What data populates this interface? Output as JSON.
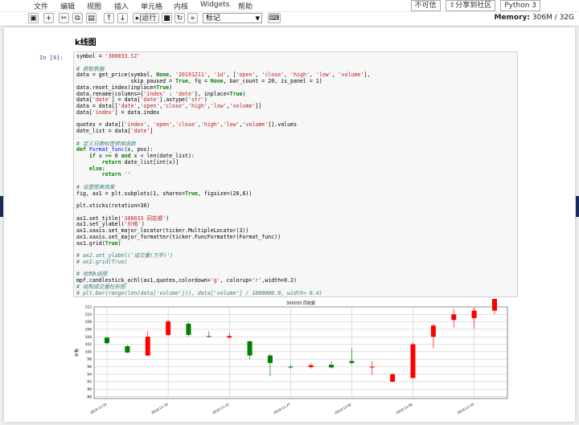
{
  "menu": [
    "文件",
    "编辑",
    "视图",
    "插入",
    "单元格",
    "内核",
    "Widgets",
    "帮助"
  ],
  "kernel": {
    "trusted": "不可信",
    "share": "分享到社区",
    "language": "Python 3"
  },
  "toolbar": {
    "run_label": "运行",
    "cell_type": "标记"
  },
  "memory": {
    "label": "Memory:",
    "value": "306M / 32G"
  },
  "heading": "k线图",
  "cell": {
    "prompt": "In  [9]:",
    "lines": [
      [
        [
          "",
          "symbol = "
        ],
        [
          "st",
          "'300033.SZ'"
        ]
      ],
      [],
      [
        [
          "cm",
          "# 获取数据"
        ]
      ],
      [
        [
          "",
          "data = get_price(symbol, "
        ],
        [
          "kw",
          "None"
        ],
        [
          "",
          ", "
        ],
        [
          "st",
          "'20191211'"
        ],
        [
          "",
          ", "
        ],
        [
          "st",
          "'1d'"
        ],
        [
          "",
          ", ["
        ],
        [
          "st",
          "'open'"
        ],
        [
          "",
          ", "
        ],
        [
          "st",
          "'close'"
        ],
        [
          "",
          ", "
        ],
        [
          "st",
          "'high'"
        ],
        [
          "",
          ", "
        ],
        [
          "st",
          "'low'"
        ],
        [
          "",
          ", "
        ],
        [
          "st",
          "'volume'"
        ],
        [
          "",
          "],"
        ]
      ],
      [
        [
          "",
          "                 skip_paused = "
        ],
        [
          "kw",
          "True"
        ],
        [
          "",
          ", fq = "
        ],
        [
          "kw",
          "None"
        ],
        [
          "",
          ", bar_count = 20, is_panel = 1)"
        ]
      ],
      [
        [
          "",
          "data.reset_index(inplace="
        ],
        [
          "kw",
          "True"
        ],
        [
          "",
          ")"
        ]
      ],
      [
        [
          "",
          "data.rename(columns={"
        ],
        [
          "st",
          "'index'"
        ],
        [
          "",
          " : "
        ],
        [
          "st",
          "'date'"
        ],
        [
          "",
          "}, inplace="
        ],
        [
          "kw",
          "True"
        ],
        [
          "",
          ")"
        ]
      ],
      [
        [
          "",
          "data["
        ],
        [
          "st",
          "'date'"
        ],
        [
          "",
          "] = data["
        ],
        [
          "st",
          "'date'"
        ],
        [
          "",
          "].astype("
        ],
        [
          "st",
          "'str'"
        ],
        [
          "",
          ")"
        ]
      ],
      [
        [
          "",
          "data = data[["
        ],
        [
          "st",
          "'date'"
        ],
        [
          "",
          ","
        ],
        [
          "st",
          "'open'"
        ],
        [
          "",
          ","
        ],
        [
          "st",
          "'close'"
        ],
        [
          "",
          ","
        ],
        [
          "st",
          "'high'"
        ],
        [
          "",
          ","
        ],
        [
          "st",
          "'low'"
        ],
        [
          "",
          ","
        ],
        [
          "st",
          "'volume'"
        ],
        [
          "",
          "]]"
        ]
      ],
      [
        [
          "",
          "data["
        ],
        [
          "st",
          "'index'"
        ],
        [
          "",
          "] = data.index"
        ]
      ],
      [],
      [
        [
          "",
          "quotes = data[["
        ],
        [
          "st",
          "'index'"
        ],
        [
          "",
          ", "
        ],
        [
          "st",
          "'open'"
        ],
        [
          "",
          ","
        ],
        [
          "st",
          "'close'"
        ],
        [
          "",
          ","
        ],
        [
          "st",
          "'high'"
        ],
        [
          "",
          ","
        ],
        [
          "st",
          "'low'"
        ],
        [
          "",
          ","
        ],
        [
          "st",
          "'volume'"
        ],
        [
          "",
          "]].values"
        ]
      ],
      [
        [
          "",
          "date_list = data["
        ],
        [
          "st",
          "'date'"
        ],
        [
          "",
          "]"
        ]
      ],
      [],
      [
        [
          "cm",
          "# 定义日期标签转换函数"
        ]
      ],
      [
        [
          "kw",
          "def "
        ],
        [
          "fn",
          "Format_func"
        ],
        [
          "",
          "(x, pos):"
        ]
      ],
      [
        [
          "",
          "    "
        ],
        [
          "kw",
          "if"
        ],
        [
          "",
          " x "
        ],
        [
          "kw",
          ">="
        ],
        [
          "",
          " 0 "
        ],
        [
          "kw",
          "and"
        ],
        [
          "",
          " x < len(date_list):"
        ]
      ],
      [
        [
          "",
          "        "
        ],
        [
          "kw",
          "return"
        ],
        [
          "",
          " date_list[int(x)]"
        ]
      ],
      [
        [
          "",
          "    "
        ],
        [
          "kw",
          "else"
        ],
        [
          "",
          ":"
        ]
      ],
      [
        [
          "",
          "        "
        ],
        [
          "kw",
          "return"
        ],
        [
          "",
          " "
        ],
        [
          "st",
          "''"
        ]
      ],
      [],
      [
        [
          "cm",
          "# 设置图表效果"
        ]
      ],
      [
        [
          "",
          "fig, ax1 = plt.subplots(1, sharex="
        ],
        [
          "kw",
          "True"
        ],
        [
          "",
          ", figsize=(20,6))"
        ]
      ],
      [],
      [
        [
          "",
          "plt.xticks(rotation=30)"
        ]
      ],
      [],
      [
        [
          "",
          "ax1.set_title("
        ],
        [
          "st",
          "'300033 同花顺'"
        ],
        [
          "",
          ")"
        ]
      ],
      [
        [
          "",
          "ax1.set_ylabel("
        ],
        [
          "st",
          "'价格'"
        ],
        [
          "",
          ")"
        ]
      ],
      [
        [
          "",
          "ax1.xaxis.set_major_locator(ticker.MultipleLocator(3))"
        ]
      ],
      [
        [
          "",
          "ax1.xaxis.set_major_formatter(ticker.FuncFormatter(Format_func))"
        ]
      ],
      [
        [
          "",
          "ax1.grid("
        ],
        [
          "kw",
          "True"
        ],
        [
          "",
          ")"
        ]
      ],
      [],
      [
        [
          "cm",
          "# ax2.set_ylabel('成交量(万手)')"
        ]
      ],
      [
        [
          "cm",
          "# ax2.grid(True)"
        ]
      ],
      [],
      [
        [
          "cm",
          "# 绘制k线图"
        ]
      ],
      [
        [
          "",
          "mpf.candlestick_ochl(ax1,quotes,colordown="
        ],
        [
          "st",
          "'g'"
        ],
        [
          "",
          ", colorup="
        ],
        [
          "st",
          "'r'"
        ],
        [
          "",
          ",width=0.2)"
        ]
      ],
      [
        [
          "cm",
          "# 绘制成交量柱形图"
        ]
      ],
      [
        [
          "cm",
          "# plt.bar(range(len(data['volume'])), data['volume'] / 1000000.0, width= 0.4)"
        ]
      ],
      [],
      [
        [
          "",
          "plt.show()"
        ]
      ]
    ]
  },
  "chart_data": {
    "type": "candlestick",
    "title": "300033 同花顺",
    "ylabel": "价格",
    "ylim": [
      87.5,
      112
    ],
    "yticks": [
      88,
      90,
      92,
      94,
      96,
      98,
      100,
      102,
      104,
      106,
      108,
      110,
      112
    ],
    "xticks": [
      {
        "index": 0,
        "label": "2019-11-14"
      },
      {
        "index": 3,
        "label": "2019-11-19"
      },
      {
        "index": 6,
        "label": "2019-11-22"
      },
      {
        "index": 9,
        "label": "2019-11-27"
      },
      {
        "index": 12,
        "label": "2019-12-02"
      },
      {
        "index": 15,
        "label": "2019-12-05"
      },
      {
        "index": 18,
        "label": "2019-12-10"
      }
    ],
    "up_color": "#ff0000",
    "down_color": "#008000",
    "grid": true,
    "candles": [
      {
        "open": 103.8,
        "close": 102.3,
        "high": 104.0,
        "low": 102.0
      },
      {
        "open": 101.5,
        "close": 99.8,
        "high": 101.8,
        "low": 99.6
      },
      {
        "open": 99.0,
        "close": 104.0,
        "high": 105.5,
        "low": 98.8
      },
      {
        "open": 104.5,
        "close": 108.1,
        "high": 108.5,
        "low": 104.2
      },
      {
        "open": 107.5,
        "close": 104.5,
        "high": 108.0,
        "low": 104.0
      },
      {
        "open": 104.2,
        "close": 104.0,
        "high": 105.5,
        "low": 103.8
      },
      {
        "open": 103.8,
        "close": 104.2,
        "high": 105.0,
        "low": 103.5
      },
      {
        "open": 102.8,
        "close": 99.0,
        "high": 103.0,
        "low": 98.0
      },
      {
        "open": 99.0,
        "close": 97.0,
        "high": 99.5,
        "low": 93.5
      },
      {
        "open": 96.0,
        "close": 95.8,
        "high": 96.5,
        "low": 95.5
      },
      {
        "open": 95.9,
        "close": 96.4,
        "high": 97.0,
        "low": 95.5
      },
      {
        "open": 96.5,
        "close": 95.8,
        "high": 97.5,
        "low": 95.5
      },
      {
        "open": 97.5,
        "close": 97.0,
        "high": 101.0,
        "low": 96.5
      },
      {
        "open": 96.0,
        "close": 96.0,
        "high": 97.5,
        "low": 93.8
      },
      {
        "open": 92.0,
        "close": 94.0,
        "high": 94.2,
        "low": 91.8
      },
      {
        "open": 93.0,
        "close": 102.0,
        "high": 102.5,
        "low": 92.8
      },
      {
        "open": 104.0,
        "close": 107.0,
        "high": 107.5,
        "low": 101.0
      },
      {
        "open": 108.5,
        "close": 110.0,
        "high": 111.5,
        "low": 106.5
      },
      {
        "open": 109.0,
        "close": 111.0,
        "high": 111.8,
        "low": 106.2
      },
      {
        "open": 111.0,
        "close": 115.0,
        "high": 115.5,
        "low": 110.0
      }
    ]
  }
}
